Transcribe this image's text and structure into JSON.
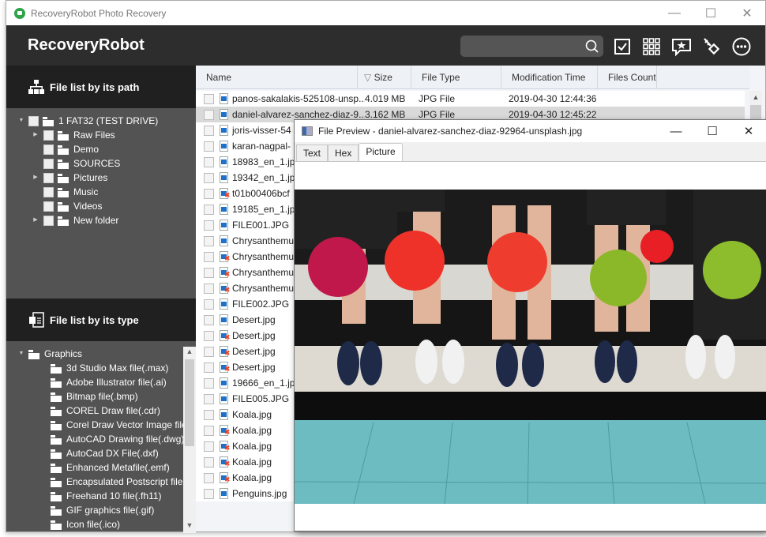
{
  "window": {
    "title": "RecoveryRobot Photo Recovery",
    "controls": {
      "minimize": "—",
      "maximize": "☐",
      "close": "✕"
    }
  },
  "header": {
    "brand": "RecoveryRobot",
    "search": {
      "value": "",
      "placeholder": ""
    },
    "tools": [
      {
        "name": "select-all",
        "icon": "checkbox-icon"
      },
      {
        "name": "grid-view",
        "icon": "grid-icon"
      },
      {
        "name": "feedback",
        "icon": "star-speech-bubble-icon"
      },
      {
        "name": "register",
        "icon": "key-icon"
      },
      {
        "name": "more",
        "icon": "more-dots-icon"
      }
    ]
  },
  "left_panel": {
    "path_section": {
      "title": "File list by its path",
      "root": "1 FAT32 (TEST DRIVE)",
      "folders": [
        {
          "label": "Raw Files",
          "expandable": true
        },
        {
          "label": "Demo",
          "expandable": false
        },
        {
          "label": "SOURCES",
          "expandable": false
        },
        {
          "label": "Pictures",
          "expandable": true
        },
        {
          "label": "Music",
          "expandable": false
        },
        {
          "label": "Videos",
          "expandable": false
        },
        {
          "label": "New folder",
          "expandable": true
        }
      ]
    },
    "type_section": {
      "title": "File list by its type",
      "root": "Graphics",
      "types": [
        "3d Studio Max file(.max)",
        "Adobe Illustrator file(.ai)",
        "Bitmap file(.bmp)",
        "COREL Draw file(.cdr)",
        "Corel Draw Vector Image file(",
        "AutoCAD Drawing file(.dwg)",
        "AutoCad DX File(.dxf)",
        "Enhanced Metafile(.emf)",
        "Encapsulated Postscript file(.e",
        "Freehand 10 file(.fh11)",
        "GIF graphics file(.gif)",
        "Icon file(.ico)"
      ]
    }
  },
  "file_list": {
    "columns": [
      "Name",
      "Size",
      "File Type",
      "Modification Time",
      "Files Count"
    ],
    "sort_indicator": "▽",
    "rows": [
      {
        "name": "panos-sakalakis-525108-unsp...",
        "size": "4.019 MB",
        "type": "JPG File",
        "modified": "2019-04-30 12:44:36",
        "deleted": false,
        "selected": false
      },
      {
        "name": "daniel-alvarez-sanchez-diaz-9...",
        "size": "3.162 MB",
        "type": "JPG File",
        "modified": "2019-04-30 12:45:22",
        "deleted": false,
        "selected": true
      },
      {
        "name": "joris-visser-54",
        "size": "",
        "type": "",
        "modified": "",
        "deleted": false,
        "selected": false
      },
      {
        "name": "karan-nagpal-",
        "size": "",
        "type": "",
        "modified": "",
        "deleted": false,
        "selected": false
      },
      {
        "name": "18983_en_1.jp",
        "size": "",
        "type": "",
        "modified": "",
        "deleted": false,
        "selected": false
      },
      {
        "name": "19342_en_1.jp",
        "size": "",
        "type": "",
        "modified": "",
        "deleted": false,
        "selected": false
      },
      {
        "name": "t01b00406bcf",
        "size": "",
        "type": "",
        "modified": "",
        "deleted": true,
        "selected": false
      },
      {
        "name": "19185_en_1.jp",
        "size": "",
        "type": "",
        "modified": "",
        "deleted": false,
        "selected": false
      },
      {
        "name": "FILE001.JPG",
        "size": "",
        "type": "",
        "modified": "",
        "deleted": false,
        "selected": false
      },
      {
        "name": "Chrysanthemu",
        "size": "",
        "type": "",
        "modified": "",
        "deleted": false,
        "selected": false
      },
      {
        "name": "Chrysanthemu",
        "size": "",
        "type": "",
        "modified": "",
        "deleted": true,
        "selected": false
      },
      {
        "name": "Chrysanthemu",
        "size": "",
        "type": "",
        "modified": "",
        "deleted": true,
        "selected": false
      },
      {
        "name": "Chrysanthemu",
        "size": "",
        "type": "",
        "modified": "",
        "deleted": true,
        "selected": false
      },
      {
        "name": "FILE002.JPG",
        "size": "",
        "type": "",
        "modified": "",
        "deleted": false,
        "selected": false
      },
      {
        "name": "Desert.jpg",
        "size": "",
        "type": "",
        "modified": "",
        "deleted": false,
        "selected": false
      },
      {
        "name": "Desert.jpg",
        "size": "",
        "type": "",
        "modified": "",
        "deleted": true,
        "selected": false
      },
      {
        "name": "Desert.jpg",
        "size": "",
        "type": "",
        "modified": "",
        "deleted": true,
        "selected": false
      },
      {
        "name": "Desert.jpg",
        "size": "",
        "type": "",
        "modified": "",
        "deleted": true,
        "selected": false
      },
      {
        "name": "19666_en_1.jp",
        "size": "",
        "type": "",
        "modified": "",
        "deleted": false,
        "selected": false
      },
      {
        "name": "FILE005.JPG",
        "size": "",
        "type": "",
        "modified": "",
        "deleted": false,
        "selected": false
      },
      {
        "name": "Koala.jpg",
        "size": "",
        "type": "",
        "modified": "",
        "deleted": false,
        "selected": false
      },
      {
        "name": "Koala.jpg",
        "size": "",
        "type": "",
        "modified": "",
        "deleted": true,
        "selected": false
      },
      {
        "name": "Koala.jpg",
        "size": "",
        "type": "",
        "modified": "",
        "deleted": true,
        "selected": false
      },
      {
        "name": "Koala.jpg",
        "size": "",
        "type": "",
        "modified": "",
        "deleted": true,
        "selected": false
      },
      {
        "name": "Koala.jpg",
        "size": "",
        "type": "",
        "modified": "",
        "deleted": true,
        "selected": false
      },
      {
        "name": "Penguins.jpg",
        "size": "",
        "type": "",
        "modified": "",
        "deleted": false,
        "selected": false
      }
    ]
  },
  "preview": {
    "title": "File Preview - daniel-alvarez-sanchez-diaz-92964-unsplash.jpg",
    "tabs": [
      "Text",
      "Hex",
      "Picture"
    ],
    "active_tab": "Picture",
    "image_description": "Five people holding bowling balls (pink, red, red-orange, green, green) above bowling shoes on a black and white floor with turquoise tiles"
  },
  "colors": {
    "header_bg": "#2d2d2d",
    "section_head_bg": "#202020",
    "panel_bg": "#535353",
    "accent_green": "#2fa24a",
    "file_icon_blue": "#1e70c9",
    "deleted_mark": "#e8442a"
  }
}
